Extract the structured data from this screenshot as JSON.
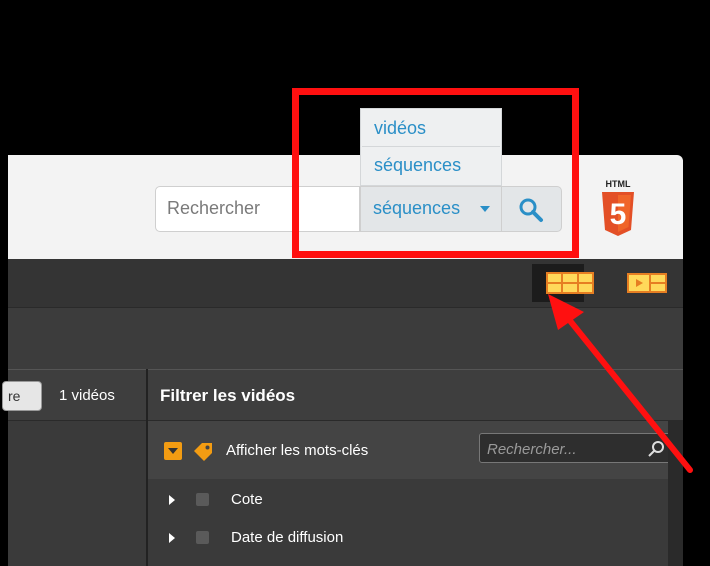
{
  "header": {
    "search_placeholder": "Rechercher",
    "scope_selected": "séquences",
    "scope_options": [
      "vidéos",
      "séquences"
    ],
    "html5_badge": "HTML",
    "html5_number": "5"
  },
  "left_panel": {
    "partial_button": "re",
    "count": "1 vidéos"
  },
  "filter_panel": {
    "title": "Filtrer les vidéos",
    "keywords_label": "Afficher les mots-clés",
    "keywords_search_placeholder": "Rechercher...",
    "tree": [
      {
        "label": "Cote"
      },
      {
        "label": "Date de diffusion"
      }
    ]
  },
  "colors": {
    "accent": "#2a8fc7",
    "highlight": "#ff1010",
    "orange": "#f39c12",
    "html5": "#e34f26"
  },
  "icons": [
    "caret-down-icon",
    "search-icon",
    "html5-logo",
    "grid-view-icon",
    "filmstrip-view-icon",
    "tag-icon",
    "arrow-annotation"
  ]
}
